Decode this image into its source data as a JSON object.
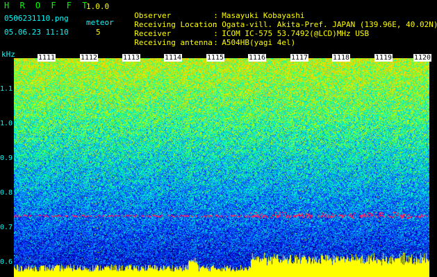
{
  "header": {
    "app_title": "H R O F F T",
    "app_version": "1.0.0",
    "file_name": "0506231110.png",
    "meteor_label": "meteor",
    "date_time": "05.06.23 11:10",
    "meteor_count": "5"
  },
  "info": [
    {
      "label": "Observer",
      "value": "Masayuki Kobayashi"
    },
    {
      "label": "Receiving Location",
      "value": "Ogata-vill. Akita-Pref. JAPAN (139.96E, 40.02N)"
    },
    {
      "label": "Receiver",
      "value": "ICOM IC-575 53.7492(@LCD)MHz USB"
    },
    {
      "label": "Receiving antenna",
      "value": "A504HB(yagi 4el)"
    }
  ],
  "axis": {
    "y_title": "kHz",
    "y_ticks": [
      "1.1",
      "1.0",
      "0.9",
      "0.8",
      "0.7",
      "0.6"
    ],
    "x_ticks": [
      "1111",
      "1112",
      "1113",
      "1114",
      "1115",
      "1116",
      "1117",
      "1118",
      "1119",
      "1120"
    ]
  },
  "colors": {
    "background": "#000000",
    "text_yellow": "#ffff00",
    "text_cyan": "#00ffff",
    "title_green": "#00ff00",
    "echo_red": "#ff2060",
    "baseline_yellow": "#ffff00"
  }
}
